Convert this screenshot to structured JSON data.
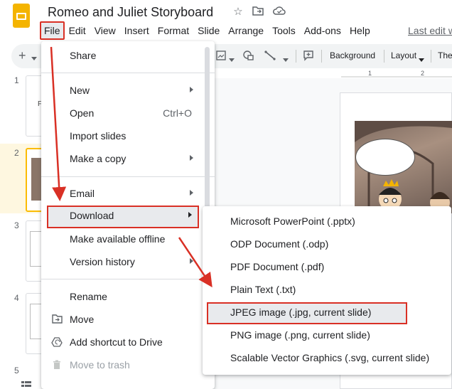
{
  "app": {
    "title": "Romeo and Juliet Storyboard",
    "last_edit": "Last edit w",
    "accent_color": "#f4b400",
    "annotation_color": "#d93025"
  },
  "menubar": {
    "items": [
      "File",
      "Edit",
      "View",
      "Insert",
      "Format",
      "Slide",
      "Arrange",
      "Tools",
      "Add-ons",
      "Help"
    ]
  },
  "toolbar": {
    "add": "+",
    "background": "Background",
    "layout": "Layout",
    "theme": "The"
  },
  "ruler": {
    "marks": [
      "1",
      "2"
    ]
  },
  "filmstrip": {
    "slide_numbers": [
      "1",
      "2",
      "3",
      "4",
      "5"
    ],
    "selected": "2"
  },
  "file_menu": {
    "items": [
      {
        "label": "Share",
        "icon": "",
        "shortcut": "",
        "submenu": false
      },
      {
        "label": "New",
        "icon": "",
        "shortcut": "",
        "submenu": true
      },
      {
        "label": "Open",
        "icon": "",
        "shortcut": "Ctrl+O",
        "submenu": false
      },
      {
        "label": "Import slides",
        "icon": "",
        "shortcut": "",
        "submenu": false
      },
      {
        "label": "Make a copy",
        "icon": "",
        "shortcut": "",
        "submenu": true
      },
      {
        "label": "Email",
        "icon": "",
        "shortcut": "",
        "submenu": true
      },
      {
        "label": "Download",
        "icon": "",
        "shortcut": "",
        "submenu": true
      },
      {
        "label": "Make available offline",
        "icon": "",
        "shortcut": "",
        "submenu": false
      },
      {
        "label": "Version history",
        "icon": "",
        "shortcut": "",
        "submenu": true
      },
      {
        "label": "Rename",
        "icon": "",
        "shortcut": "",
        "submenu": false
      },
      {
        "label": "Move",
        "icon": "move-icon",
        "shortcut": "",
        "submenu": false
      },
      {
        "label": "Add shortcut to Drive",
        "icon": "drive-shortcut-icon",
        "shortcut": "",
        "submenu": false
      },
      {
        "label": "Move to trash",
        "icon": "trash-icon",
        "shortcut": "",
        "submenu": false,
        "disabled": true
      }
    ]
  },
  "download_menu": {
    "items": [
      "Microsoft PowerPoint (.pptx)",
      "ODP Document (.odp)",
      "PDF Document (.pdf)",
      "Plain Text (.txt)",
      "JPEG image (.jpg, current slide)",
      "PNG image (.png, current slide)",
      "Scalable Vector Graphics (.svg, current slide)"
    ],
    "highlighted": "JPEG image (.jpg, current slide)"
  }
}
